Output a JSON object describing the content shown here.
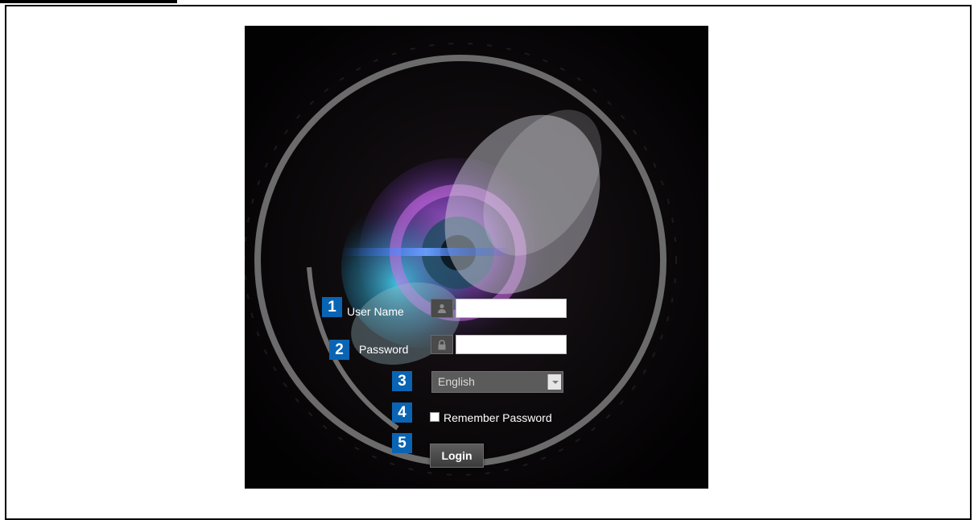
{
  "login": {
    "username_label": "User Name",
    "username_value": "",
    "password_label": "Password",
    "password_value": "",
    "language_selected": "English",
    "remember_label": "Remember Password",
    "remember_checked": false,
    "login_button": "Login"
  },
  "callouts": [
    "1",
    "2",
    "3",
    "4",
    "5"
  ],
  "icons": {
    "username": "user-icon",
    "password": "lock-icon",
    "language_dropdown": "chevron-down-icon"
  },
  "colors": {
    "page_background": "#ffffff",
    "panel_background": "#050305",
    "callout_badge": "#0a64b4",
    "dropdown_background": "#5b5b5b",
    "button_background": "#4a4a4a"
  }
}
